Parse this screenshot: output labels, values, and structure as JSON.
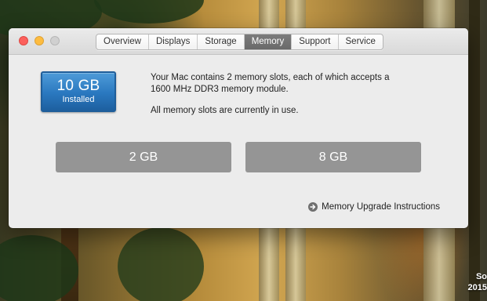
{
  "window": {
    "tabs": [
      {
        "label": "Overview"
      },
      {
        "label": "Displays"
      },
      {
        "label": "Storage"
      },
      {
        "label": "Memory"
      },
      {
        "label": "Support"
      },
      {
        "label": "Service"
      }
    ],
    "active_tab": "Memory"
  },
  "memory": {
    "installed_total": "10 GB",
    "installed_caption": "Installed",
    "description_line_1": "Your Mac contains 2 memory slots, each of which accepts a 1600 MHz DDR3 memory module.",
    "description_line_2": "All memory slots are currently in use.",
    "slots": [
      {
        "label": "2 GB"
      },
      {
        "label": "8 GB"
      }
    ],
    "upgrade_link_label": "Memory Upgrade Instructions"
  },
  "desktop": {
    "corner_text_line_1": "So",
    "corner_text_line_2": "2015"
  },
  "colors": {
    "badge_blue": "#2a78bf",
    "slot_gray": "#959595",
    "active_tab_gray": "#6a6a6a",
    "close_red": "#fc605c",
    "minimize_yellow": "#fdbc40"
  },
  "icons": {
    "upgrade_link_icon": "arrow-circle-right-icon"
  }
}
